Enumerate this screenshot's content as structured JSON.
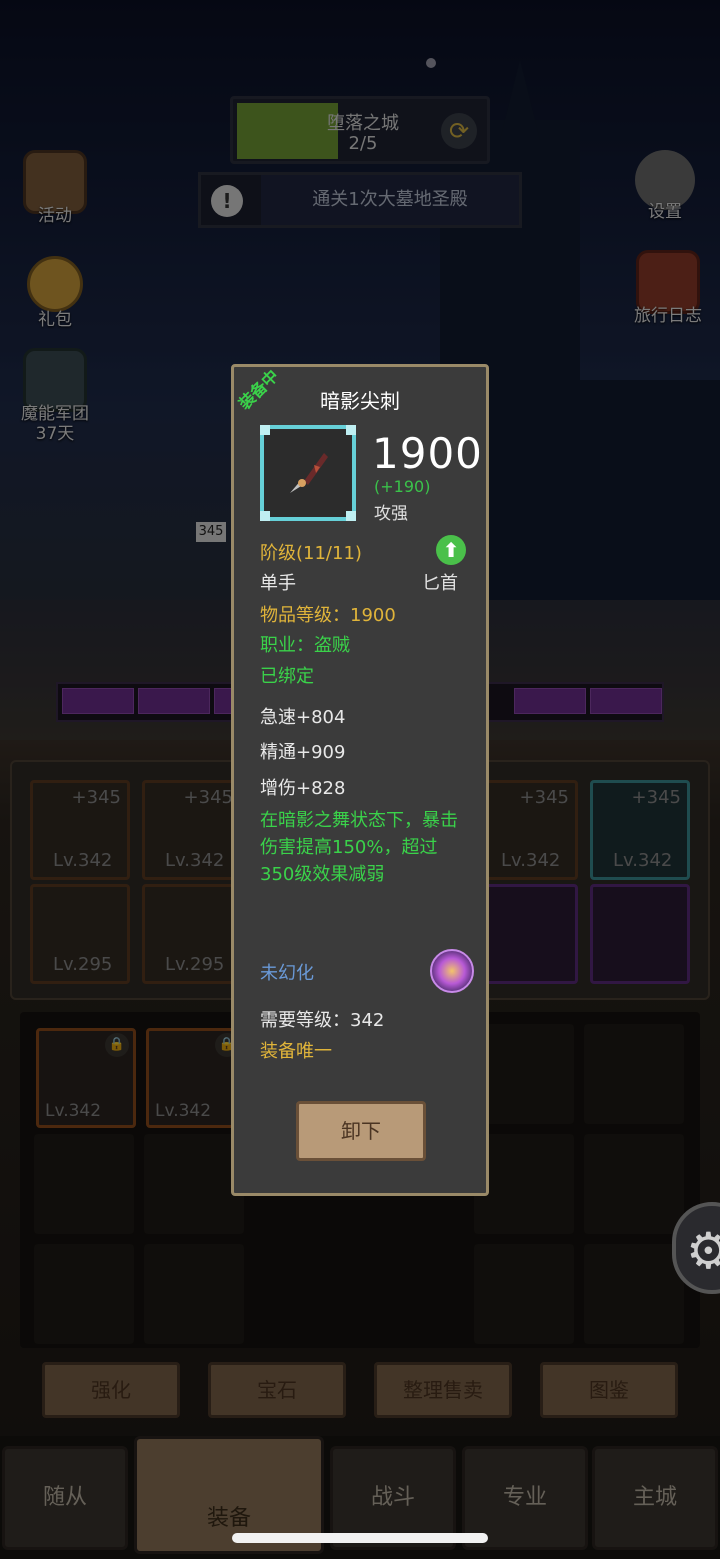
{
  "hud": {
    "stage_title": "堕落之城",
    "stage_progress": "2/5",
    "stage_progress_fraction": 0.4,
    "quest_text": "通关1次大墓地圣殿",
    "left_icons": [
      {
        "label": "活动",
        "icon": "activity-scroll-icon"
      },
      {
        "label": "礼包",
        "icon": "gift-helmet-icon"
      },
      {
        "label": "魔能军团",
        "sub": "37天",
        "icon": "legion-emblem-icon"
      }
    ],
    "right_icons": [
      {
        "label": "设置",
        "icon": "gear-icon"
      },
      {
        "label": "旅行日志",
        "icon": "travel-log-book-icon"
      }
    ],
    "sign_number": "345"
  },
  "equipment_slots": [
    {
      "level": "Lv.342",
      "plus": "+345",
      "rarity": "orange"
    },
    {
      "level": "Lv.342",
      "plus": "+345",
      "rarity": "orange"
    },
    {
      "level": "Lv.342",
      "plus": "+345",
      "rarity": "orange"
    },
    {
      "level": "Lv.342",
      "plus": "+345",
      "rarity": "blue"
    },
    {
      "level": "Lv.295",
      "plus": "",
      "rarity": "orange"
    },
    {
      "level": "Lv.295",
      "plus": "",
      "rarity": "orange"
    }
  ],
  "bag_items": [
    {
      "level": "Lv.342",
      "locked": true
    },
    {
      "level": "Lv.342",
      "locked": true
    }
  ],
  "actions": [
    "强化",
    "宝石",
    "整理售卖",
    "图鉴"
  ],
  "tabs": [
    "随从",
    "装备",
    "战斗",
    "专业",
    "主城"
  ],
  "active_tab": "装备",
  "tooltip": {
    "banner": "装备中",
    "name": "暗影尖刺",
    "power": "1900",
    "power_delta": "(+190)",
    "power_label": "攻强",
    "tier": "阶级(11/11)",
    "hand": "单手",
    "weapon_type": "匕首",
    "item_level": "物品等级：1900",
    "class": "职业：盗贼",
    "bound": "已绑定",
    "stats": [
      "急速+804",
      "精通+909",
      "增伤+828"
    ],
    "effect": "在暗影之舞状态下，暴击伤害提高150%，超过350级效果减弱",
    "transmog": "未幻化",
    "req_level": "需要等级：342",
    "unique": "装备唯一",
    "unequip_label": "卸下"
  },
  "colors": {
    "rarity_orange": "#8a4a1a",
    "rarity_blue": "#3a8a90",
    "stat_green": "#3ad24a",
    "gold_text": "#e0b43a",
    "transmog_blue": "#6a9ad8"
  }
}
